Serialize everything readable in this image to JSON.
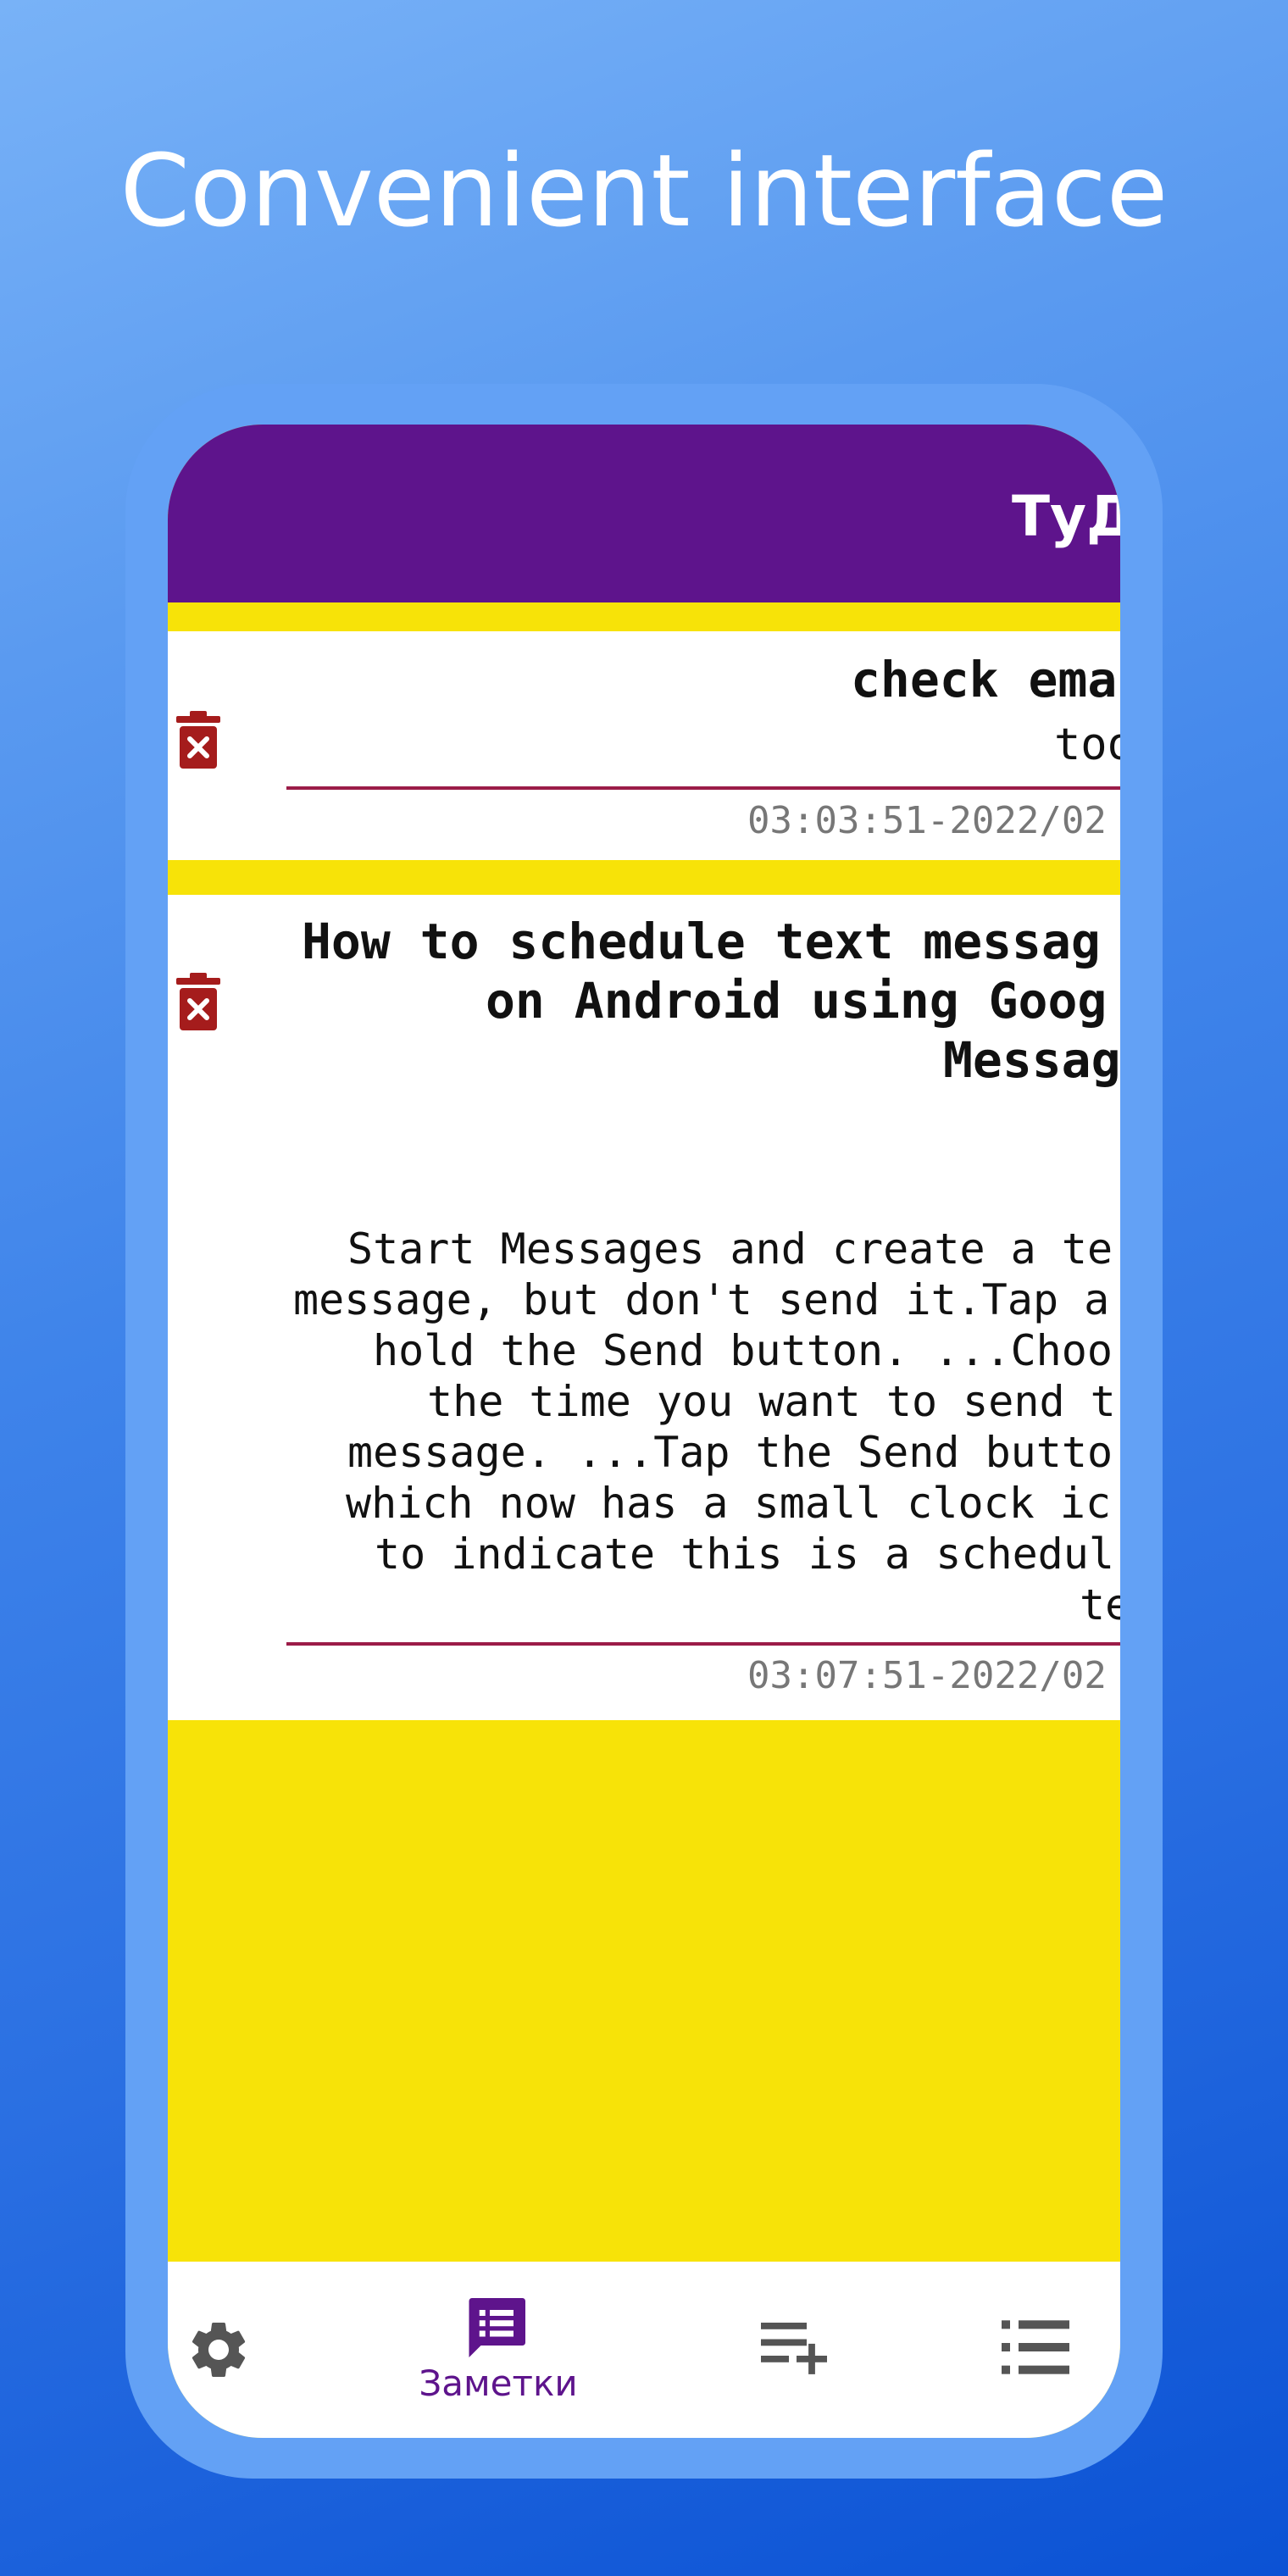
{
  "promo": {
    "headline": "Convenient interface"
  },
  "app": {
    "title": "ТуД"
  },
  "colors": {
    "app_bar": "#5e148c",
    "screen_background": "#f7e308",
    "card": "#ffffff",
    "divider": "#9b1c48",
    "delete_icon": "#a51c1c",
    "nav_active": "#5e148c",
    "nav_inactive": "#555555",
    "device_frame": "#63a1f5"
  },
  "notes": [
    {
      "title": "check ema",
      "subtitle": "too",
      "timestamp": "03:03:51-2022/02",
      "delete_icon": "trash-x-icon"
    },
    {
      "title_lines": [
        "How to schedule text messag",
        "on Android using Goog",
        "Messag"
      ],
      "body_lines": [
        "Start Messages and create a te",
        "message, but don't send it.Tap a",
        "hold the Send button. ...Choo",
        "the time you want to send t",
        "message. ...Tap the Send butto",
        "which now has a small clock ic",
        "to indicate this is a schedul",
        "te"
      ],
      "timestamp": "03:07:51-2022/02",
      "delete_icon": "trash-x-icon"
    }
  ],
  "bottom_nav": {
    "active": "notes",
    "items": [
      {
        "id": "settings",
        "icon": "gear-icon",
        "label": ""
      },
      {
        "id": "notes",
        "icon": "notes-icon",
        "label": "Заметки"
      },
      {
        "id": "add",
        "icon": "playlist-add-icon",
        "label": ""
      },
      {
        "id": "list",
        "icon": "list-icon",
        "label": ""
      }
    ]
  }
}
